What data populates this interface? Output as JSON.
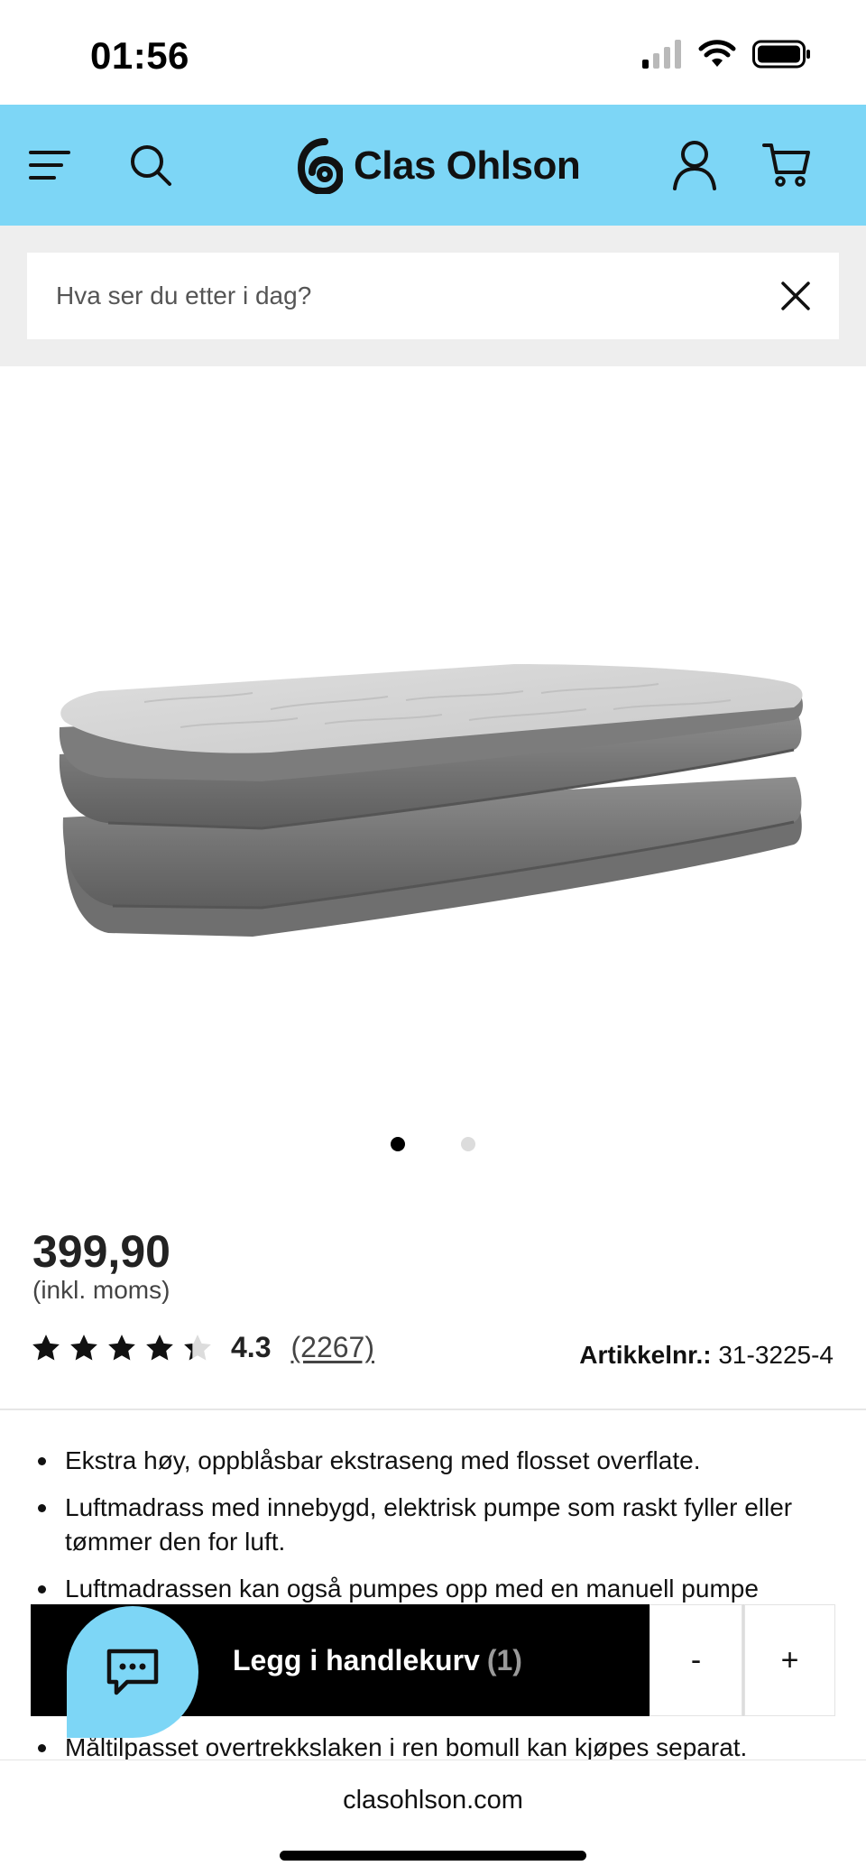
{
  "status_bar": {
    "time": "01:56"
  },
  "header": {
    "brand": "Clas Ohlson",
    "brand_color": "#7dd6f6"
  },
  "search": {
    "placeholder": "Hva ser du etter i dag?"
  },
  "product": {
    "image_icon": "air-mattress-image",
    "image_count": 2,
    "active_image": 1,
    "price": "399,90",
    "vat_note": "(inkl. moms)",
    "rating": "4.3",
    "rating_stars": 4.3,
    "review_count": "(2267)",
    "article_label": "Artikkelnr.:",
    "article_number": "31-3225-4",
    "features": [
      "Ekstra høy, oppblåsbar ekstraseng med flosset overflate.",
      "Luftmadrass med innebygd, elektrisk pumpe som raskt fyller eller tømmer den for luft.",
      "Luftmadrassen kan også pumpes opp med en manuell pumpe"
    ],
    "feature_partial": "Måltilpasset overtrekkslaken i ren bomull kan kjøpes separat."
  },
  "cart": {
    "add_label": "Legg i handlekurv",
    "quantity": "(1)",
    "minus": "-",
    "plus": "+"
  },
  "browser": {
    "url": "clasohlson.com"
  }
}
